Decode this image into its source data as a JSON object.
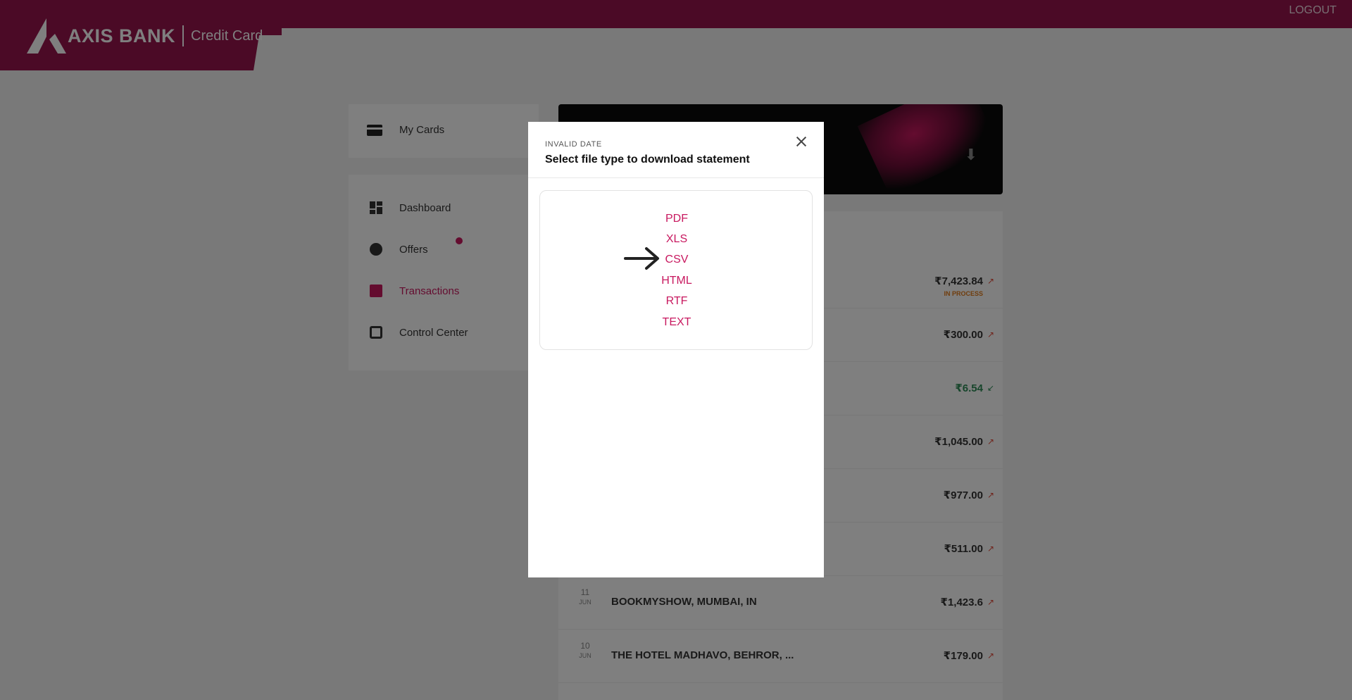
{
  "header": {
    "brand": "AXIS BANK",
    "product": "Credit Card",
    "logout_label": "LOGOUT",
    "brand_color": "#97144d"
  },
  "sidebar": {
    "my_cards_label": "My Cards",
    "items": [
      {
        "label": "Dashboard",
        "icon": "dashboard-icon"
      },
      {
        "label": "Offers",
        "icon": "offers-icon",
        "has_badge": true
      },
      {
        "label": "Transactions",
        "icon": "transactions-icon",
        "active": true
      },
      {
        "label": "Control Center",
        "icon": "control-center-icon"
      }
    ]
  },
  "transactions": [
    {
      "date": "",
      "month": "",
      "merchant": "",
      "ref": "",
      "amount": "₹7,423.84",
      "type": "debit",
      "status": "IN PROCESS"
    },
    {
      "date": "",
      "month": "",
      "merchant": "",
      "ref": "",
      "amount": "₹300.00",
      "type": "debit",
      "status": ""
    },
    {
      "date": "",
      "month": "",
      "merchant": "",
      "ref": "",
      "amount": "₹6.54",
      "type": "credit",
      "status": ""
    },
    {
      "date": "",
      "month": "",
      "merchant": "",
      "ref": "",
      "amount": "₹1,045.00",
      "type": "debit",
      "status": ""
    },
    {
      "date": "",
      "month": "",
      "merchant": "",
      "ref": "",
      "amount": "₹977.00",
      "type": "debit",
      "status": ""
    },
    {
      "date": "",
      "month": "",
      "merchant": "",
      "ref": "",
      "amount": "₹511.00",
      "type": "debit",
      "status": ""
    },
    {
      "date": "11",
      "month": "JUN",
      "merchant": "BOOKMYSHOW, MUMBAI, IN",
      "ref": "",
      "amount": "₹1,423.6",
      "type": "debit",
      "status": ""
    },
    {
      "date": "10",
      "month": "JUN",
      "merchant": "THE HOTEL MADHAVO, BEHROR, ...",
      "ref": "",
      "amount": "₹179.00",
      "type": "debit",
      "status": ""
    }
  ],
  "modal": {
    "subtitle": "INVALID DATE",
    "title": "Select file type to download statement",
    "options": [
      "PDF",
      "XLS",
      "CSV",
      "HTML",
      "RTF",
      "TEXT"
    ],
    "accent_color": "#c8185f"
  }
}
